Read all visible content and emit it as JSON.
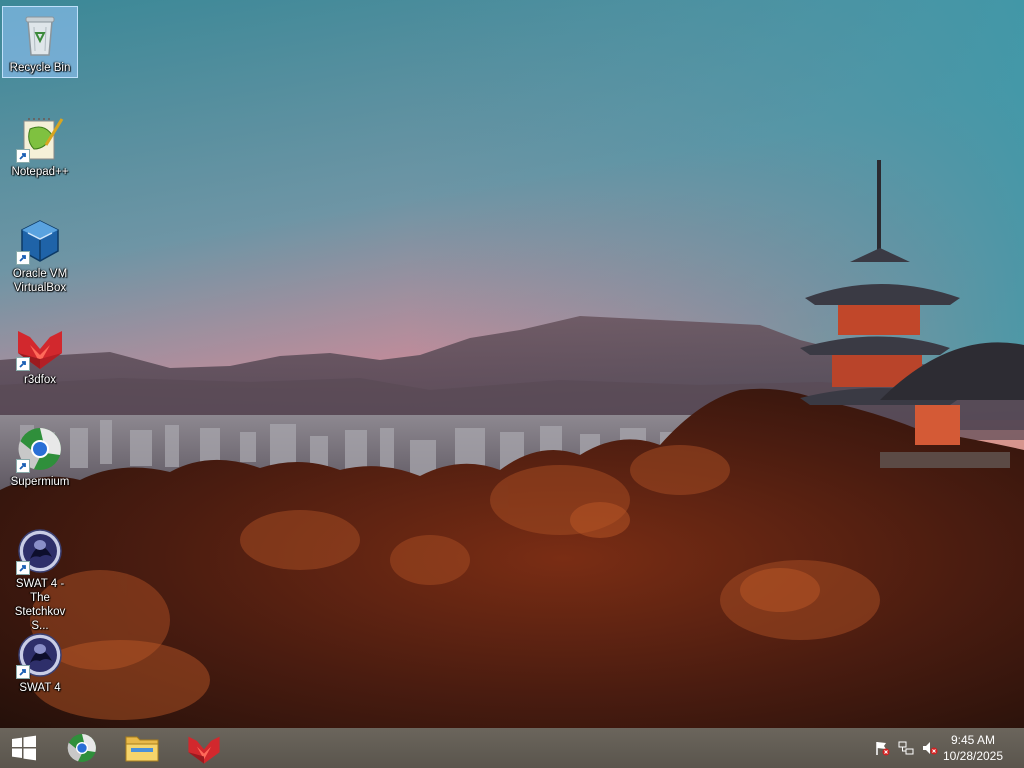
{
  "desktop": {
    "icons": [
      {
        "label": "Recycle Bin",
        "icon": "recycle-bin-icon",
        "shortcut": false,
        "selected": true
      },
      {
        "label": "Notepad++",
        "icon": "notepad-plus-plus-icon",
        "shortcut": true,
        "selected": false
      },
      {
        "label": "Oracle VM VirtualBox",
        "icon": "virtualbox-icon",
        "shortcut": true,
        "selected": false
      },
      {
        "label": "r3dfox",
        "icon": "r3dfox-icon",
        "shortcut": true,
        "selected": false
      },
      {
        "label": "Supermium",
        "icon": "supermium-icon",
        "shortcut": true,
        "selected": false
      },
      {
        "label": "SWAT 4 - The Stetchkov S...",
        "icon": "swat4-icon",
        "shortcut": true,
        "selected": false
      },
      {
        "label": "SWAT 4",
        "icon": "swat4-icon",
        "shortcut": true,
        "selected": false
      }
    ]
  },
  "taskbar": {
    "start_icon": "windows-start-icon",
    "pinned": [
      {
        "name": "Supermium",
        "icon": "supermium-icon"
      },
      {
        "name": "File Explorer",
        "icon": "folder-icon"
      },
      {
        "name": "r3dfox",
        "icon": "r3dfox-icon"
      }
    ],
    "tray": {
      "icons": [
        "action-center-flag-icon",
        "network-icon",
        "volume-muted-icon"
      ],
      "time": "9:45 AM",
      "date": "10/28/2025"
    }
  },
  "colors": {
    "taskbar": "#5e5950",
    "selection": "#99c9ff",
    "sky_top": "#3f8a9a",
    "sky_horizon": "#d98f95"
  }
}
